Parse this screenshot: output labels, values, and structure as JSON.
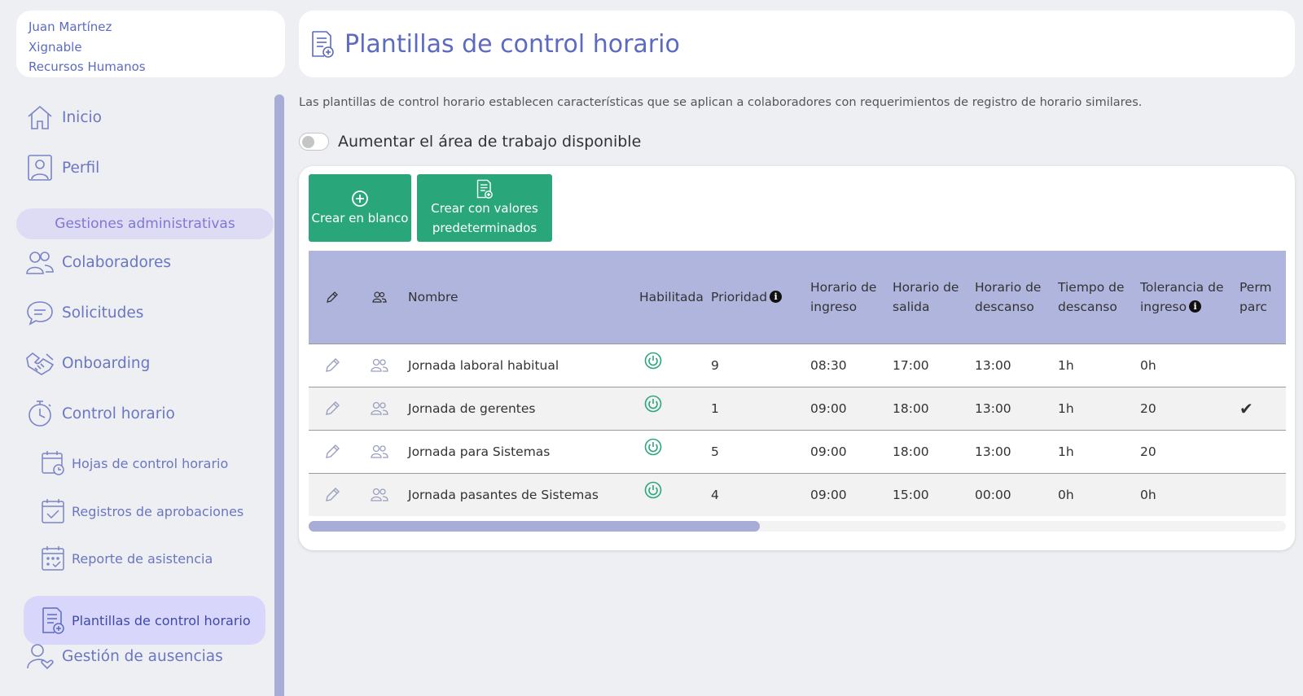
{
  "user": {
    "name": "Juan Martínez",
    "company": "Xignable",
    "department": "Recursos Humanos"
  },
  "sidebar": {
    "items": [
      {
        "label": "Inicio",
        "icon": "home-icon"
      },
      {
        "label": "Perfil",
        "icon": "profile-icon"
      }
    ],
    "section_label": "Gestiones administrativas",
    "admin_items": [
      {
        "label": "Colaboradores",
        "icon": "users-icon"
      },
      {
        "label": "Solicitudes",
        "icon": "chat-icon"
      },
      {
        "label": "Onboarding",
        "icon": "handshake-icon"
      },
      {
        "label": "Control horario",
        "icon": "stopwatch-icon"
      }
    ],
    "sub_items": [
      {
        "label": "Hojas de control horario",
        "icon": "calendar-clock-icon"
      },
      {
        "label": "Registros de aprobaciones",
        "icon": "calendar-check-icon"
      },
      {
        "label": "Reporte de asistencia",
        "icon": "calendar-icon"
      },
      {
        "label": "Plantillas de control horario",
        "icon": "template-icon",
        "active": true
      }
    ],
    "bottom_item": {
      "label": "Gestión de ausencias",
      "icon": "user-heart-icon"
    }
  },
  "header": {
    "title": "Plantillas de control horario"
  },
  "description": "Las plantillas de control horario establecen características que se aplican a colaboradores con requerimientos de registro de horario similares.",
  "toggle": {
    "label": "Aumentar el área de trabajo disponible",
    "on": false
  },
  "buttons": {
    "create_blank": "Crear en blanco",
    "create_default_line1": "Crear con valores",
    "create_default_line2": "predeterminados"
  },
  "table": {
    "columns": {
      "nombre": "Nombre",
      "habilitada": "Habilitada",
      "prioridad": "Prioridad",
      "ingreso_1": "Horario de",
      "ingreso_2": "ingreso",
      "salida_1": "Horario de",
      "salida_2": "salida",
      "descanso_h_1": "Horario de",
      "descanso_h_2": "descanso",
      "tiempo_1": "Tiempo de",
      "tiempo_2": "descanso",
      "tolerancia_1": "Tolerancia de",
      "tolerancia_2": "ingreso",
      "perm_1": "Perm",
      "perm_2": "parc"
    },
    "rows": [
      {
        "nombre": "Jornada laboral habitual",
        "habilitada": true,
        "prioridad": "9",
        "ingreso": "08:30",
        "salida": "17:00",
        "descanso": "13:00",
        "tiempo": "1h",
        "tolerancia": "0h",
        "permite": ""
      },
      {
        "nombre": "Jornada de gerentes",
        "habilitada": true,
        "prioridad": "1",
        "ingreso": "09:00",
        "salida": "18:00",
        "descanso": "13:00",
        "tiempo": "1h",
        "tolerancia": "20",
        "permite": "✔"
      },
      {
        "nombre": "Jornada para Sistemas",
        "habilitada": true,
        "prioridad": "5",
        "ingreso": "09:00",
        "salida": "18:00",
        "descanso": "13:00",
        "tiempo": "1h",
        "tolerancia": "20",
        "permite": ""
      },
      {
        "nombre": "Jornada pasantes de Sistemas",
        "habilitada": true,
        "prioridad": "4",
        "ingreso": "09:00",
        "salida": "15:00",
        "descanso": "00:00",
        "tiempo": "0h",
        "tolerancia": "0h",
        "permite": ""
      }
    ]
  },
  "colors": {
    "accent": "#5c6bc0",
    "button_green": "#2aa77a",
    "table_header": "#b0b5de",
    "power_icon": "#2aa77a"
  }
}
